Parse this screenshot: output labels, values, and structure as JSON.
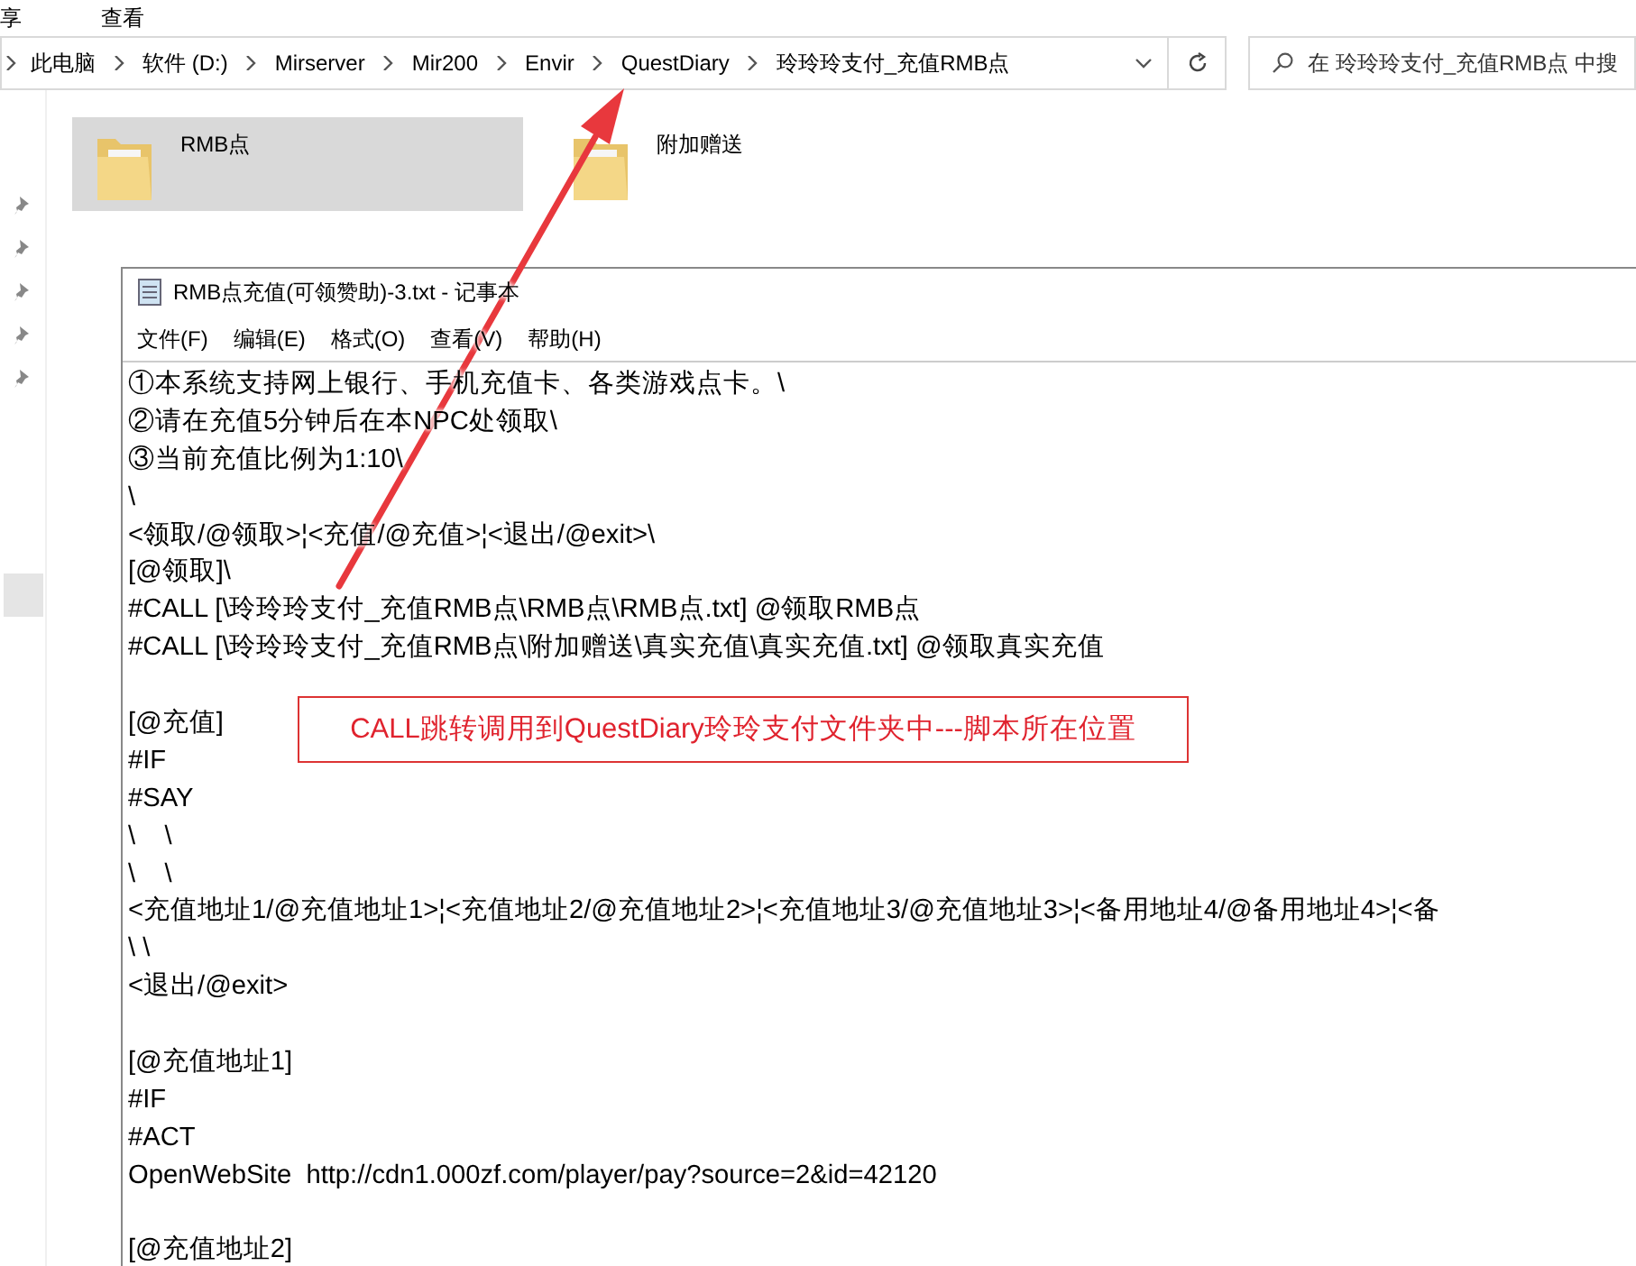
{
  "ribbon_tabs": [
    "享",
    "查看"
  ],
  "address_bar": {
    "crumbs": [
      "此电脑",
      "软件 (D:)",
      "Mirserver",
      "Mir200",
      "Envir",
      "QuestDiary",
      "玲玲玲支付_充值RMB点"
    ]
  },
  "search": {
    "placeholder": "在 玲玲玲支付_充值RMB点 中搜"
  },
  "folders": [
    {
      "name": "RMB点",
      "selected": true
    },
    {
      "name": "附加赠送",
      "selected": false
    }
  ],
  "notepad": {
    "title": "RMB点充值(可领赞助)-3.txt - 记事本",
    "menu": [
      "文件(F)",
      "编辑(E)",
      "格式(O)",
      "查看(V)",
      "帮助(H)"
    ],
    "lines": [
      {
        "kind": "text",
        "text": "①本系统支持网上银行、手机充值卡、各类游戏点卡。\\"
      },
      {
        "kind": "text",
        "text": "②请在充值5分钟后在本NPC处领取\\"
      },
      {
        "kind": "text",
        "text": "③当前充值比例为1:10\\"
      },
      {
        "kind": "text",
        "text": "\\"
      },
      {
        "kind": "text",
        "text": "<领取/@领取>¦<充值/@充值>¦<退出/@exit>\\"
      },
      {
        "kind": "text",
        "text": "[@领取]\\"
      },
      {
        "kind": "text",
        "text": "#CALL [\\玲玲玲支付_充值RMB点\\RMB点\\RMB点.txt] @领取RMB点"
      },
      {
        "kind": "text",
        "text": "#CALL [\\玲玲玲支付_充值RMB点\\附加赠送\\真实充值\\真实充值.txt] @领取真实充值"
      },
      {
        "kind": "blank"
      },
      {
        "kind": "text",
        "text": "[@充值]"
      },
      {
        "kind": "text",
        "text": "#IF"
      },
      {
        "kind": "text",
        "text": "#SAY"
      },
      {
        "kind": "text",
        "text": "\\    \\"
      },
      {
        "kind": "text",
        "text": "\\    \\"
      },
      {
        "kind": "text",
        "text": "<充值地址1/@充值地址1>¦<充值地址2/@充值地址2>¦<充值地址3/@充值地址3>¦<备用地址4/@备用地址4>¦<备"
      },
      {
        "kind": "text",
        "text": "\\ \\"
      },
      {
        "kind": "text",
        "text": "<退出/@exit>"
      },
      {
        "kind": "blank"
      },
      {
        "kind": "text",
        "text": "[@充值地址1]"
      },
      {
        "kind": "text",
        "text": "#IF"
      },
      {
        "kind": "text",
        "text": "#ACT"
      },
      {
        "kind": "text",
        "text": "OpenWebSite  http://cdn1.000zf.com/player/pay?source=2&id=42120"
      },
      {
        "kind": "blank"
      },
      {
        "kind": "text",
        "text": "[@充值地址2]"
      }
    ]
  },
  "annotation": {
    "text": "CALL跳转调用到QuestDiary玲玲支付文件夹中---脚本所在位置"
  }
}
